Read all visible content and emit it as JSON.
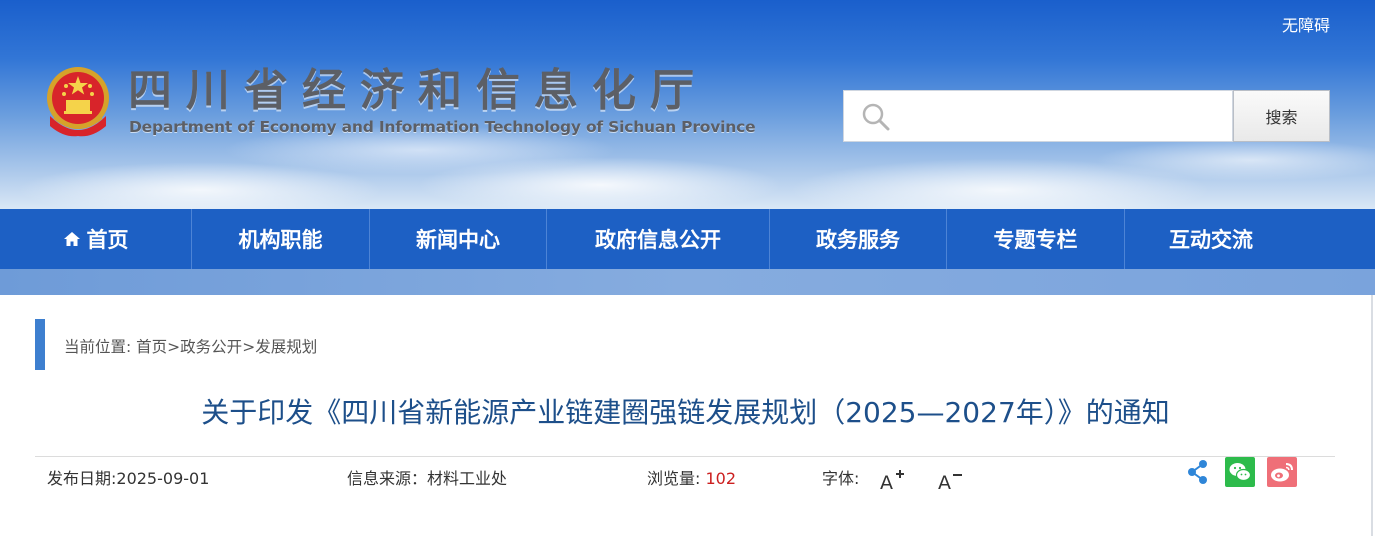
{
  "header": {
    "accessibility_label": "无障碍",
    "site_title": "四川省经济和信息化厅",
    "site_subtitle": "Department of Economy and Information Technology of Sichuan Province",
    "search": {
      "placeholder": "",
      "value": "",
      "button_label": "搜索"
    }
  },
  "nav": {
    "items": [
      {
        "label": "首页",
        "icon": "home-icon"
      },
      {
        "label": "机构职能"
      },
      {
        "label": "新闻中心"
      },
      {
        "label": "政府信息公开"
      },
      {
        "label": "政务服务"
      },
      {
        "label": "专题专栏"
      },
      {
        "label": "互动交流"
      }
    ]
  },
  "breadcrumb": {
    "prefix": "当前位置: ",
    "items": [
      "首页",
      "政务公开",
      "发展规划"
    ],
    "separator": ">"
  },
  "article": {
    "title": "关于印发《四川省新能源产业链建圈强链发展规划（2025—2027年）》的通知",
    "publish_date": "发布日期:2025-09-01",
    "source": "信息来源：材料工业处",
    "views_label": "浏览量: ",
    "views_count": "102",
    "font_size_label": "字体:",
    "font_increase_icon": "A+",
    "font_decrease_icon": "A-"
  },
  "share": {
    "icons": [
      "share-icon",
      "wechat-icon",
      "weibo-icon"
    ]
  },
  "colors": {
    "nav_bg": "#1d60c4",
    "title_blue": "#1d4f8a",
    "accent_bar": "#3d7fcf",
    "views_red": "#cc1f1f",
    "wechat_green": "#2dbb4b",
    "weibo_pink": "#ef6f78",
    "share_blue": "#2f86d8"
  }
}
